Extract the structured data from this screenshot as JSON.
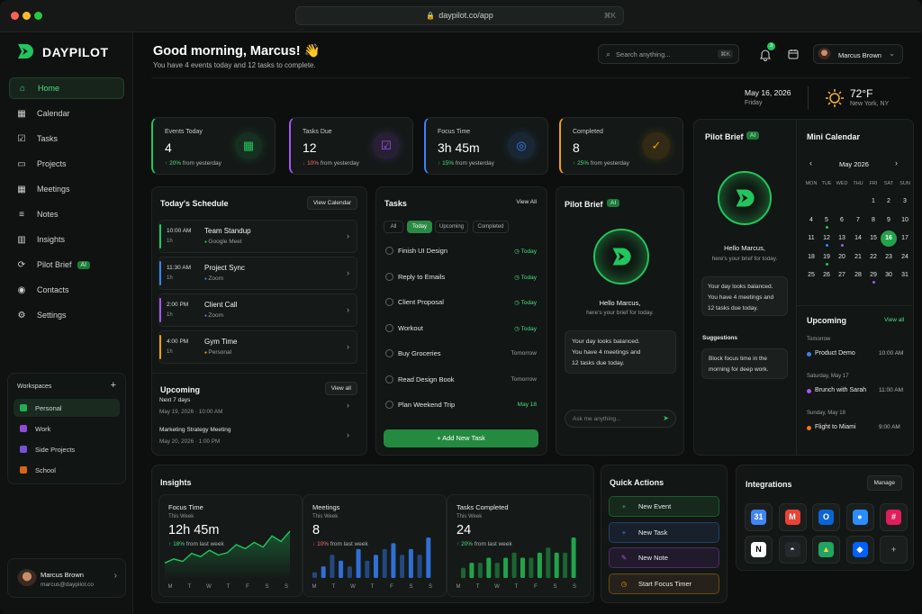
{
  "browser": {
    "url": "daypilot.co/app",
    "shortcut": "⌘K"
  },
  "app": {
    "name": "DAYPILOT"
  },
  "colors": {
    "accent": "#4ade80",
    "blue": "#3b82f6",
    "purple": "#a855f7",
    "orange": "#f59e0b",
    "red": "#ef4444"
  },
  "sidebar": {
    "items": [
      {
        "label": "Home",
        "icon": "home-icon"
      },
      {
        "label": "Calendar",
        "icon": "calendar-icon"
      },
      {
        "label": "Tasks",
        "icon": "checkbox-icon"
      },
      {
        "label": "Projects",
        "icon": "folder-icon"
      },
      {
        "label": "Meetings",
        "icon": "calendar-icon"
      },
      {
        "label": "Notes",
        "icon": "notes-icon"
      },
      {
        "label": "Insights",
        "icon": "chart-icon"
      },
      {
        "label": "Pilot Brief",
        "icon": "pilot-icon",
        "badge": "AI"
      },
      {
        "label": "Contacts",
        "icon": "contacts-icon"
      },
      {
        "label": "Settings",
        "icon": "gear-icon"
      }
    ],
    "workspaces": {
      "title": "Workspaces",
      "add": "+",
      "items": [
        {
          "label": "Personal",
          "color": "#22c55e"
        },
        {
          "label": "Work",
          "color": "#a855f7"
        },
        {
          "label": "Side Projects",
          "color": "#8b5cf6"
        },
        {
          "label": "School",
          "color": "#f97316"
        }
      ]
    },
    "user": {
      "name": "Marcus Brown",
      "email": "marcus@daypilot.co"
    }
  },
  "header": {
    "greeting": "Good morning, Marcus! 👋",
    "subtitle": "You have 4 events today and 12 tasks to complete.",
    "search_placeholder": "Search anything...",
    "search_shortcut": "⌘K",
    "notification_count": "3",
    "profile_name": "Marcus Brown"
  },
  "date_weather": {
    "date": "May 16, 2026",
    "day": "Friday",
    "temp": "72°F",
    "location": "New York, NY"
  },
  "stats": [
    {
      "label": "Events Today",
      "value": "4",
      "change": "20%",
      "change_suffix": "from yesterday",
      "direction": "up",
      "color": "#22c55e",
      "icon": "calendar-icon"
    },
    {
      "label": "Tasks Due",
      "value": "12",
      "change": "10%",
      "change_suffix": "from yesterday",
      "direction": "down",
      "color": "#a855f7",
      "icon": "checkbox-icon"
    },
    {
      "label": "Focus Time",
      "value": "3h 45m",
      "change": "15%",
      "change_suffix": "from yesterday",
      "direction": "up",
      "color": "#3b82f6",
      "icon": "target-icon"
    },
    {
      "label": "Completed",
      "value": "8",
      "change": "25%",
      "change_suffix": "from yesterday",
      "direction": "up",
      "color": "#f59e0b",
      "icon": "check-circle-icon"
    }
  ],
  "schedule": {
    "title": "Today's Schedule",
    "action": "View Calendar",
    "items": [
      {
        "time": "10:00 AM",
        "duration": "1h",
        "name": "Team Standup",
        "place": "Google Meet",
        "color": "#22c55e"
      },
      {
        "time": "11:30 AM",
        "duration": "1h",
        "name": "Project Sync",
        "place": "Zoom",
        "color": "#3b82f6"
      },
      {
        "time": "2:00 PM",
        "duration": "1h",
        "name": "Client Call",
        "place": "Zoom",
        "color": "#a855f7"
      },
      {
        "time": "4:00 PM",
        "duration": "1h",
        "name": "Gym Time",
        "place": "Personal",
        "color": "#f59e0b"
      }
    ],
    "upcoming_title": "Upcoming",
    "upcoming_action": "View all",
    "upcoming_items": [
      {
        "name": "Next 7 days",
        "date": "May 19, 2026 · 10:00 AM"
      },
      {
        "name": "Marketing Strategy Meeting",
        "date": "May 20, 2026 · 1:00 PM"
      }
    ]
  },
  "tasks": {
    "title": "Tasks",
    "action": "View All",
    "tabs": [
      "All",
      "Today",
      "Upcoming",
      "Completed"
    ],
    "items": [
      {
        "name": "Finish UI Design",
        "when": "Today"
      },
      {
        "name": "Reply to Emails",
        "when": "Today"
      },
      {
        "name": "Client Proposal",
        "when": "Today"
      },
      {
        "name": "Workout",
        "when": "Today"
      },
      {
        "name": "Buy Groceries",
        "when": "Tomorrow"
      },
      {
        "name": "Read Design Book",
        "when": "Tomorrow"
      },
      {
        "name": "Plan Weekend Trip",
        "when": "May 18"
      }
    ],
    "add_button": "+ Add New Task"
  },
  "pilot_center": {
    "title": "Pilot Brief",
    "badge": "AI",
    "hello": "Hello Marcus,",
    "sub": "here's your brief for today.",
    "message": [
      "Your day looks balanced.",
      "You have 4 meetings and",
      "12 tasks due today."
    ],
    "ask_placeholder": "Ask me anything..."
  },
  "pilot_right": {
    "title": "Pilot Brief",
    "badge": "AI",
    "hello": "Hello Marcus,",
    "sub": "here's your brief for today.",
    "message": [
      "Your day looks balanced.",
      "You have 4 meetings and",
      "12 tasks due today."
    ],
    "suggestions_title": "Suggestions",
    "suggestion": [
      "Block focus time in the",
      "morning for deep work."
    ]
  },
  "mini_calendar": {
    "title": "Mini Calendar",
    "month": "May 2026",
    "weekdays": [
      "MON",
      "TUE",
      "WED",
      "THU",
      "FRI",
      "SAT",
      "SUN"
    ],
    "weeks": [
      [
        "",
        "",
        "",
        "",
        "1",
        "2",
        "3"
      ],
      [
        "4",
        "5",
        "6",
        "7",
        "8",
        "9",
        "10"
      ],
      [
        "11",
        "12",
        "13",
        "14",
        "15",
        "16",
        "17"
      ],
      [
        "18",
        "19",
        "20",
        "21",
        "22",
        "23",
        "24"
      ],
      [
        "25",
        "26",
        "27",
        "28",
        "29",
        "30",
        "31"
      ]
    ],
    "selected": "16",
    "upcoming_title": "Upcoming",
    "upcoming_action": "View all",
    "upcoming": [
      {
        "day": "Tomorrow",
        "name": "Product Demo",
        "time": "10:00 AM",
        "color": "#3b82f6"
      },
      {
        "day": "Saturday, May 17",
        "name": "Brunch with Sarah",
        "time": "11:00 AM",
        "color": "#a855f7"
      },
      {
        "day": "Sunday, May 18",
        "name": "Flight to Miami",
        "time": "9:00 AM",
        "color": "#f97316"
      }
    ]
  },
  "insights": {
    "title": "Insights",
    "cards": [
      {
        "label": "Focus Time",
        "period": "This Week",
        "value": "12h 45m",
        "change": "18%",
        "change_suffix": "from last week",
        "direction": "up",
        "color": "#22c55e"
      },
      {
        "label": "Meetings",
        "period": "This Week",
        "value": "8",
        "change": "10%",
        "change_suffix": "from last week",
        "direction": "down",
        "color": "#3b82f6"
      },
      {
        "label": "Tasks Completed",
        "period": "This Week",
        "value": "24",
        "change": "20%",
        "change_suffix": "from last week",
        "direction": "up",
        "color": "#22c55e"
      }
    ],
    "days": [
      "M",
      "T",
      "W",
      "T",
      "F",
      "S",
      "S"
    ]
  },
  "chart_data": [
    {
      "type": "area",
      "title": "Focus Time",
      "x": [
        "M",
        "T",
        "W",
        "T",
        "F",
        "S",
        "S"
      ],
      "values": [
        2,
        2.5,
        2.2,
        3.2,
        2.8,
        3.6,
        3.0,
        3.3,
        4.3,
        3.8,
        4.6,
        4.0,
        5.4,
        4.7,
        6.0
      ]
    },
    {
      "type": "bar",
      "title": "Meetings",
      "categories": [
        "M",
        "M",
        "T",
        "T",
        "W",
        "W",
        "T",
        "T",
        "F",
        "F",
        "S",
        "S",
        "S",
        "S"
      ],
      "values": [
        1,
        2,
        4,
        3,
        2,
        5,
        3,
        4,
        5,
        6,
        4,
        5,
        4,
        7
      ]
    },
    {
      "type": "bar",
      "title": "Tasks Completed",
      "categories": [
        "M",
        "M",
        "T",
        "T",
        "W",
        "W",
        "T",
        "T",
        "F",
        "F",
        "S",
        "S",
        "S",
        "S"
      ],
      "values": [
        2,
        3,
        3,
        4,
        3,
        4,
        5,
        4,
        4,
        5,
        6,
        5,
        5,
        8
      ]
    }
  ],
  "quick_actions": {
    "title": "Quick Actions",
    "items": [
      {
        "label": "New Event",
        "icon": "+",
        "color": "#22c55e",
        "bg": "#17281d"
      },
      {
        "label": "New Task",
        "icon": "+",
        "color": "#3b82f6",
        "bg": "#17202b"
      },
      {
        "label": "New Note",
        "icon": "✎",
        "color": "#a855f7",
        "bg": "#211a2b"
      },
      {
        "label": "Start Focus Timer",
        "icon": "◷",
        "color": "#f59e0b",
        "bg": "#26211a"
      }
    ]
  },
  "integrations": {
    "title": "Integrations",
    "action": "Manage",
    "items": [
      "google-calendar-icon",
      "gmail-icon",
      "outlook-icon",
      "zoom-icon",
      "slack-icon",
      "notion-icon",
      "github-icon",
      "google-drive-icon",
      "dropbox-icon",
      "add-icon"
    ]
  }
}
